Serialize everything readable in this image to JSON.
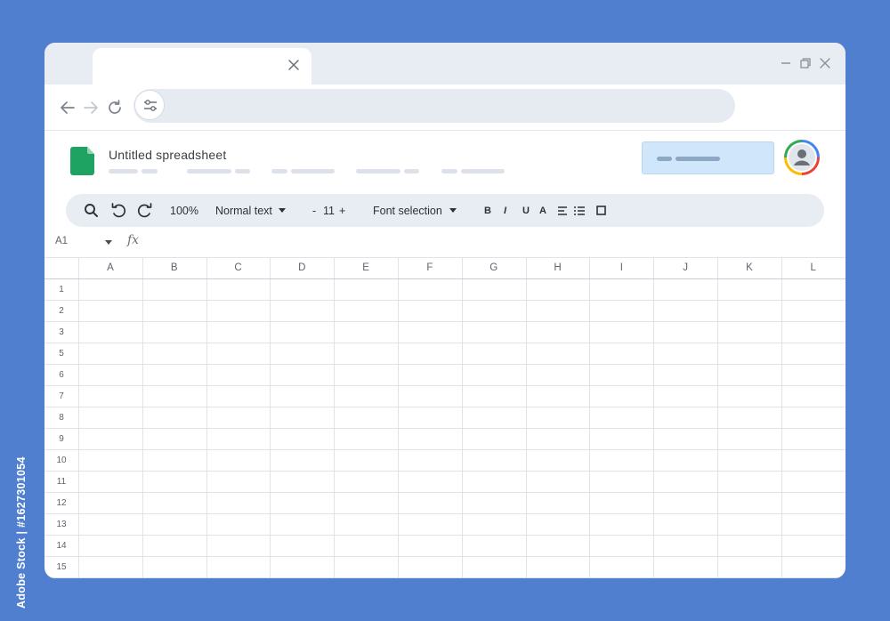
{
  "document": {
    "title": "Untitled spreadsheet"
  },
  "toolbar": {
    "zoom": "100%",
    "style": "Normal text",
    "font_size": "11",
    "font_size_dec": "-",
    "font_size_inc": "+",
    "font": "Font selection",
    "bold": "B",
    "italic": "I",
    "underline": "U",
    "text_color": "A"
  },
  "formula_bar": {
    "cell_ref": "A1",
    "fx": "fx"
  },
  "grid": {
    "columns": [
      "A",
      "B",
      "C",
      "D",
      "E",
      "F",
      "G",
      "H",
      "I",
      "J",
      "K",
      "L"
    ],
    "rows": [
      "1",
      "2",
      "3",
      "5",
      "6",
      "7",
      "8",
      "9",
      "10",
      "11",
      "12",
      "13",
      "14",
      "15"
    ]
  },
  "watermark": {
    "text": "Adobe Stock | #1627301054"
  },
  "colors": {
    "background": "#4f7fce",
    "sheets_green": "#1ea362",
    "share_button": "#cfe6fb"
  }
}
